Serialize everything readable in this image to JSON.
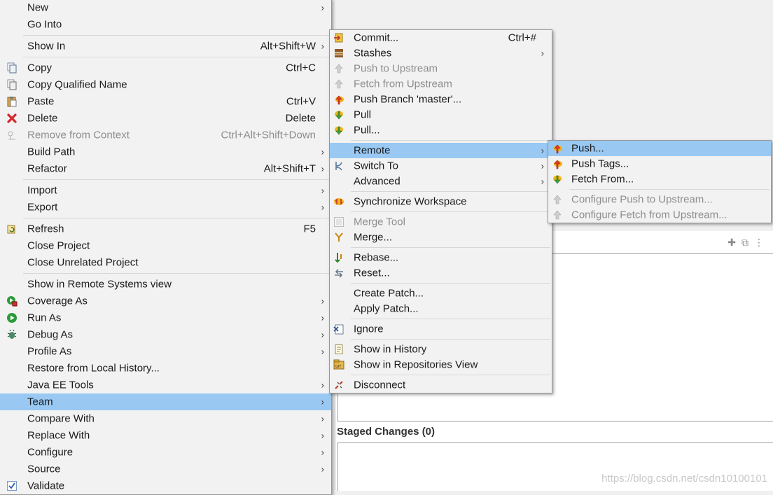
{
  "background": {
    "staged_label": "Staged Changes (0)",
    "watermark": "https://blog.csdn.net/csdn10100101"
  },
  "context_menu": {
    "items": [
      {
        "label": "New",
        "submenu": true
      },
      {
        "label": "Go Into"
      },
      {
        "label": "Show In",
        "shortcut": "Alt+Shift+W",
        "submenu": true
      },
      {
        "label": "Copy",
        "shortcut": "Ctrl+C",
        "icon": "copy-icon"
      },
      {
        "label": "Copy Qualified Name",
        "icon": "copy-qualified-icon"
      },
      {
        "label": "Paste",
        "shortcut": "Ctrl+V",
        "icon": "paste-icon"
      },
      {
        "label": "Delete",
        "shortcut": "Delete",
        "icon": "delete-icon"
      },
      {
        "label": "Remove from Context",
        "shortcut": "Ctrl+Alt+Shift+Down",
        "icon": "remove-context-icon",
        "disabled": true
      },
      {
        "label": "Build Path",
        "submenu": true
      },
      {
        "label": "Refactor",
        "shortcut": "Alt+Shift+T",
        "submenu": true
      },
      {
        "label": "Import",
        "submenu": true
      },
      {
        "label": "Export",
        "submenu": true
      },
      {
        "label": "Refresh",
        "shortcut": "F5",
        "icon": "refresh-icon"
      },
      {
        "label": "Close Project"
      },
      {
        "label": "Close Unrelated Project"
      },
      {
        "label": "Show in Remote Systems view"
      },
      {
        "label": "Coverage As",
        "icon": "coverage-icon",
        "submenu": true
      },
      {
        "label": "Run As",
        "icon": "run-icon",
        "submenu": true
      },
      {
        "label": "Debug As",
        "icon": "debug-icon",
        "submenu": true
      },
      {
        "label": "Profile As",
        "submenu": true
      },
      {
        "label": "Restore from Local History..."
      },
      {
        "label": "Java EE Tools",
        "submenu": true
      },
      {
        "label": "Team",
        "submenu": true,
        "selected": true
      },
      {
        "label": "Compare With",
        "submenu": true
      },
      {
        "label": "Replace With",
        "submenu": true
      },
      {
        "label": "Configure",
        "submenu": true
      },
      {
        "label": "Source",
        "submenu": true
      },
      {
        "label": "Validate",
        "icon": "checkbox-icon"
      }
    ]
  },
  "team_menu": {
    "items": [
      {
        "label": "Commit...",
        "shortcut": "Ctrl+#",
        "icon": "commit-icon"
      },
      {
        "label": "Stashes",
        "icon": "stash-icon",
        "submenu": true
      },
      {
        "label": "Push to Upstream",
        "icon": "push-upstream-icon",
        "disabled": true
      },
      {
        "label": "Fetch from Upstream",
        "icon": "fetch-upstream-icon",
        "disabled": true
      },
      {
        "label": "Push Branch 'master'...",
        "icon": "push-branch-icon"
      },
      {
        "label": "Pull",
        "icon": "pull-icon"
      },
      {
        "label": "Pull...",
        "icon": "pull-dialog-icon"
      },
      {
        "label": "Remote",
        "submenu": true,
        "selected": true
      },
      {
        "label": "Switch To",
        "icon": "switch-branch-icon",
        "submenu": true
      },
      {
        "label": "Advanced",
        "submenu": true
      },
      {
        "label": "Synchronize Workspace",
        "icon": "synchronize-icon"
      },
      {
        "label": "Merge Tool",
        "icon": "merge-tool-icon",
        "disabled": true
      },
      {
        "label": "Merge...",
        "icon": "merge-icon"
      },
      {
        "label": "Rebase...",
        "icon": "rebase-icon"
      },
      {
        "label": "Reset...",
        "icon": "reset-icon"
      },
      {
        "label": "Create Patch..."
      },
      {
        "label": "Apply Patch..."
      },
      {
        "label": "Ignore",
        "icon": "ignore-icon"
      },
      {
        "label": "Show in History",
        "icon": "history-icon"
      },
      {
        "label": "Show in Repositories View",
        "icon": "repositories-icon"
      },
      {
        "label": "Disconnect",
        "icon": "disconnect-icon"
      }
    ]
  },
  "remote_menu": {
    "items": [
      {
        "label": "Push...",
        "icon": "push-icon",
        "selected": true
      },
      {
        "label": "Push Tags...",
        "icon": "push-tags-icon"
      },
      {
        "label": "Fetch From...",
        "icon": "fetch-icon"
      },
      {
        "label": "Configure Push to Upstream...",
        "icon": "configure-push-icon",
        "disabled": true
      },
      {
        "label": "Configure Fetch from Upstream...",
        "icon": "configure-fetch-icon",
        "disabled": true
      }
    ]
  },
  "colors": {
    "selection": "#99c9f3",
    "menu_background": "#f2f2f2",
    "disabled_text": "#8d8d8d"
  }
}
